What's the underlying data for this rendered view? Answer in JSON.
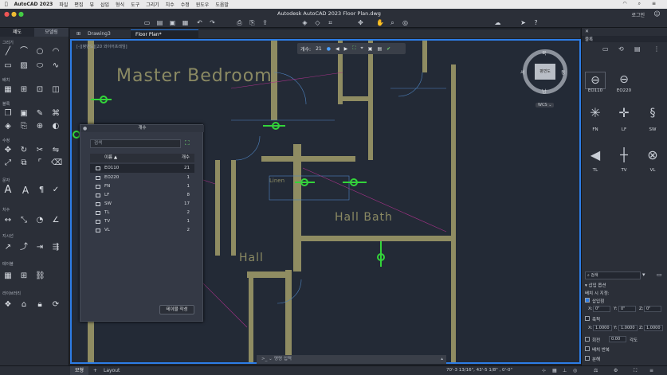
{
  "macbar": {
    "app": "AutoCAD 2023",
    "menus": [
      "파일",
      "편집",
      "뷰",
      "삽입",
      "형식",
      "도구",
      "그리기",
      "치수",
      "수정",
      "윈도우",
      "도움말"
    ]
  },
  "window": {
    "title": "Autodesk AutoCAD 2023   Floor Plan.dwg",
    "login_label": "로그인"
  },
  "left_panel": {
    "tabs": [
      "제도",
      "모델링"
    ],
    "sections": [
      "그리기",
      "배치",
      "블록",
      "수정",
      "문자",
      "치수",
      "지시선",
      "테이블",
      "라이브러리"
    ]
  },
  "doc_tabs": [
    "Drawing3",
    "Floor Plan*"
  ],
  "canvas": {
    "view_label": "[-][평면도][2D 와이어프레임]",
    "count_bar": {
      "label": "개수:",
      "value": "21"
    },
    "room_labels": [
      "Master Bedroom",
      "Hall Bath",
      "Hall",
      "Linen"
    ],
    "viewcube": {
      "face": "평면도",
      "north": "북",
      "south": "남",
      "east": "동",
      "west": "서",
      "wcs": "WCS ⌄"
    }
  },
  "count_palette": {
    "title": "개수",
    "search_placeholder": "검색",
    "col_name": "이름 ▲",
    "col_count": "개수",
    "rows": [
      {
        "name": "EO110",
        "count": "21"
      },
      {
        "name": "EO220",
        "count": "1"
      },
      {
        "name": "FN",
        "count": "1"
      },
      {
        "name": "LF",
        "count": "8"
      },
      {
        "name": "SW",
        "count": "17"
      },
      {
        "name": "TL",
        "count": "2"
      },
      {
        "name": "TV",
        "count": "1"
      },
      {
        "name": "VL",
        "count": "2"
      }
    ],
    "table_button": "테이블 작성"
  },
  "command_line": {
    "placeholder": "명령 입력"
  },
  "status": {
    "tabs": [
      "모형",
      "Layout"
    ],
    "coords": "70'-3 13/16\", 43'-5 1/8\" , 0'-0\""
  },
  "right_panel": {
    "title": "블록",
    "blocks": [
      "EO110",
      "EO220",
      "FN",
      "LF",
      "SW",
      "TL",
      "TV",
      "VL"
    ],
    "search_placeholder": "검색",
    "insert_options": "삽입 옵션",
    "insert_point": "배치 시 지정:",
    "insert_point_check": "삽입점",
    "scale": "축척",
    "rotation": "회전",
    "rotation_value": "0.00",
    "rotation_unit": "각도",
    "repeat": "배치 반복",
    "explode": "분해",
    "x_label": "X:",
    "y_label": "Y:",
    "z_label": "Z:",
    "zero": "0\"",
    "scale_value": "1.0000"
  },
  "colors": {
    "accent": "#2d7de6",
    "canvas_bg": "#232a36",
    "wall": "#8f8c62",
    "block_green": "#33d43a",
    "label_olive": "#8b8a63"
  }
}
